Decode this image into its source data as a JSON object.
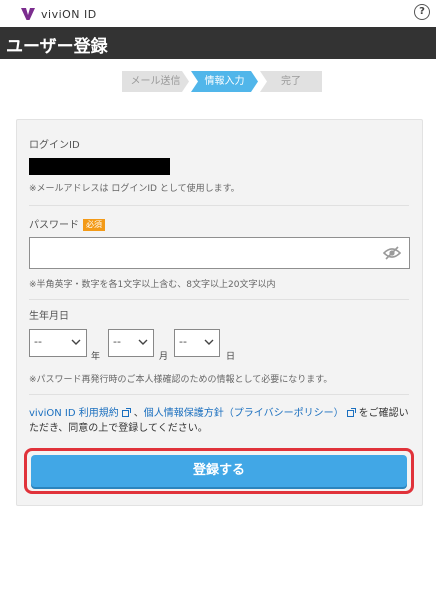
{
  "header": {
    "brand": "viviON ID",
    "help_icon": "question-circle-icon",
    "help_label": "?"
  },
  "title": "ユーザー登録",
  "steps": [
    "メール送信",
    "情報入力",
    "完了"
  ],
  "active_step": 2,
  "form": {
    "login_id": {
      "label": "ログインID",
      "note": "※メールアドレスは ログインID として使用します。"
    },
    "password": {
      "label": "パスワード",
      "required_badge": "必須",
      "value": "",
      "note": "※半角英字・数字を各1文字以上含む、8文字以上20文字以内"
    },
    "birthdate": {
      "label": "生年月日",
      "year_value": "--",
      "month_value": "--",
      "day_value": "--",
      "year_unit": "年",
      "month_unit": "月",
      "day_unit": "日",
      "note": "※パスワード再発行時のご本人様確認のための情報として必要になります。"
    },
    "terms": {
      "link1": "viviON ID 利用規約",
      "separator": "、",
      "link2": "個人情報保護方針（プライバシーポリシー）",
      "suffix": "をご確認いただき、同意の上で登録してください。"
    },
    "submit_label": "登録する"
  },
  "colors": {
    "brand": "#7b2d8e",
    "header_bg": "#333333",
    "step_active": "#51b6ea",
    "badge": "#f39a17",
    "submit": "#41a7e6",
    "highlight": "#e0323a",
    "link": "#1a6fbf"
  }
}
